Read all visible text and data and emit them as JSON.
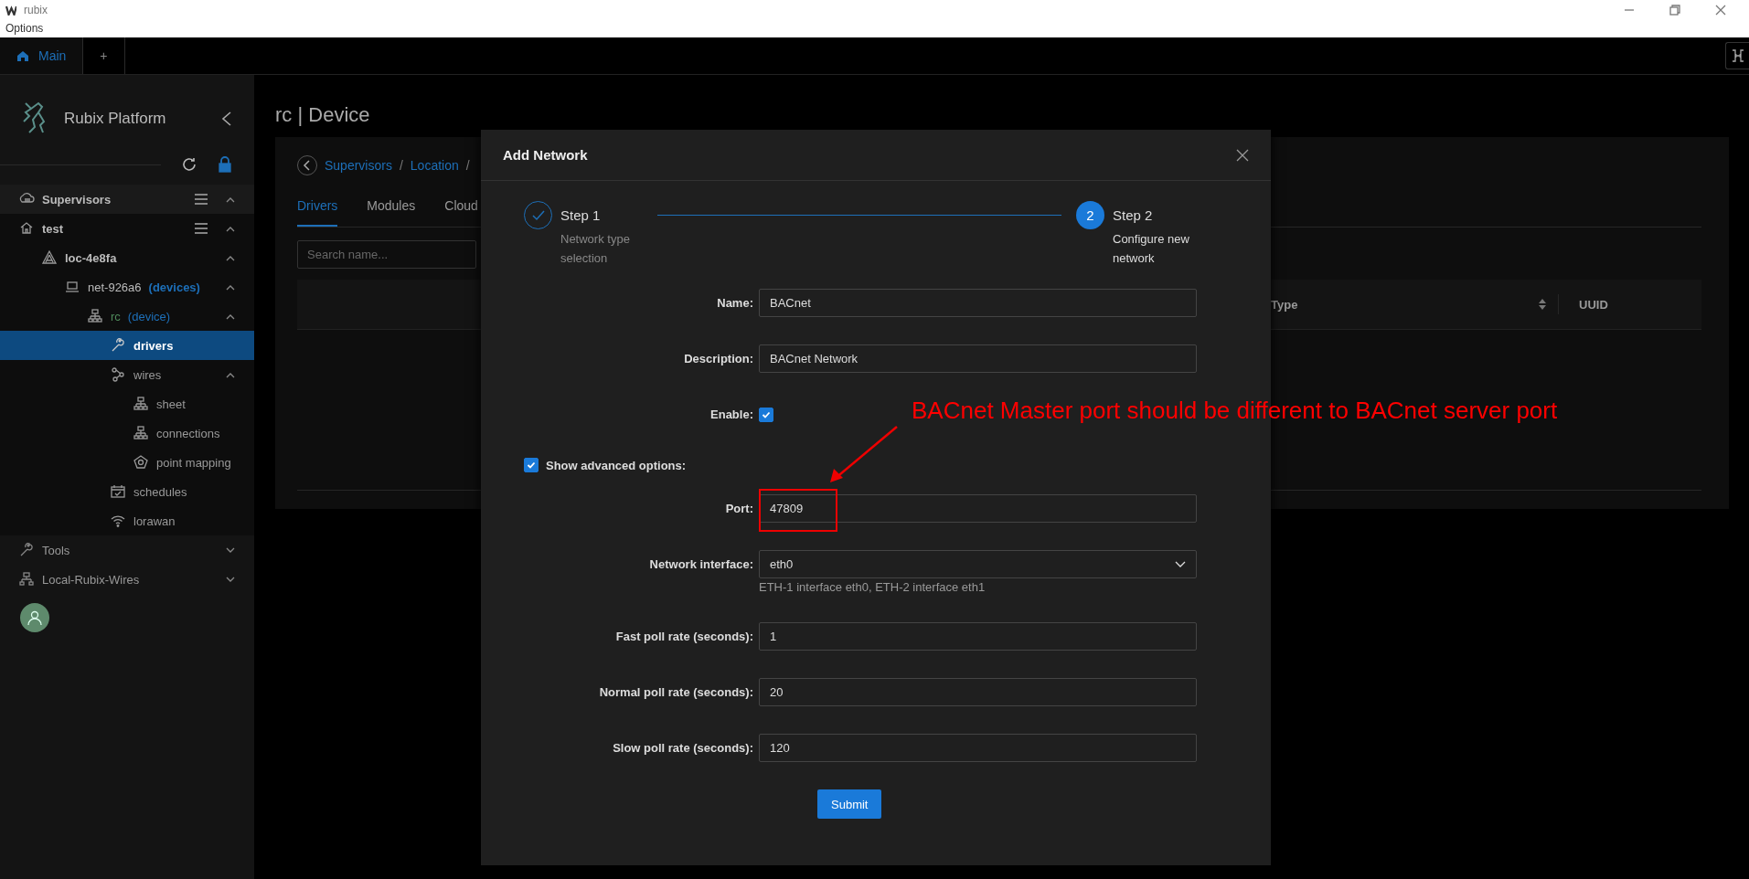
{
  "window": {
    "title": "rubix",
    "menu": [
      "Options"
    ]
  },
  "tabs": [
    {
      "label": "Main",
      "selected": true
    },
    {
      "label": "+",
      "selected": false
    }
  ],
  "sidebar": {
    "title": "Rubix Platform",
    "tree": [
      {
        "kind": "supervisors",
        "label": "Supervisors",
        "expanded": true,
        "selected": false,
        "children": [
          {
            "kind": "host",
            "label": "test",
            "expanded": true,
            "selected": false,
            "children": [
              {
                "kind": "location",
                "label": "loc-4e8fa",
                "expanded": true,
                "selected": false,
                "children": [
                  {
                    "kind": "network",
                    "label": "net-926a6",
                    "suffix": "(devices)",
                    "expanded": true,
                    "selected": false,
                    "children": [
                      {
                        "kind": "device",
                        "label": "rc",
                        "suffix": "(device)",
                        "expanded": true,
                        "selected": false,
                        "children": [
                          {
                            "kind": "drivers",
                            "label": "drivers",
                            "selected": true
                          },
                          {
                            "kind": "wires",
                            "label": "wires",
                            "expanded": true,
                            "selected": false,
                            "children": [
                              {
                                "kind": "sheet",
                                "label": "sheet",
                                "selected": false
                              },
                              {
                                "kind": "sheet",
                                "label": "connections",
                                "selected": false
                              },
                              {
                                "kind": "mapping",
                                "label": "point mapping",
                                "selected": false
                              }
                            ]
                          },
                          {
                            "kind": "schedules",
                            "label": "schedules",
                            "selected": false
                          },
                          {
                            "kind": "lorawan",
                            "label": "lorawan",
                            "selected": false
                          }
                        ]
                      }
                    ]
                  }
                ]
              }
            ]
          }
        ]
      }
    ],
    "footer": [
      {
        "kind": "tools",
        "label": "Tools",
        "expanded": false
      },
      {
        "kind": "wires-app",
        "label": "Local-Rubix-Wires",
        "expanded": false
      }
    ]
  },
  "page": {
    "title": "rc | Device",
    "breadcrumb": [
      {
        "label": "Supervisors",
        "separator": "/"
      },
      {
        "label": "Location",
        "separator": "/"
      }
    ],
    "tabs": [
      {
        "label": "Drivers",
        "selected": true
      },
      {
        "label": "Modules",
        "selected": false
      },
      {
        "label": "Cloud",
        "selected": false
      }
    ],
    "search": {
      "placeholder": "Search name..."
    },
    "table": {
      "columns": [
        {
          "label": "Type",
          "sortable": true
        },
        {
          "label": "UUID",
          "sortable": false
        }
      ]
    }
  },
  "modal": {
    "title": "Add Network",
    "steps": [
      {
        "label": "Step 1",
        "description": "Network type selection",
        "completed": true
      },
      {
        "label": "Step 2",
        "number": "2",
        "description": "Configure new network",
        "completed": false
      }
    ],
    "fields": [
      {
        "kind": "text",
        "label": "Name:",
        "value": "BACnet"
      },
      {
        "kind": "text",
        "label": "Description:",
        "value": "BACnet Network"
      },
      {
        "kind": "checkbox",
        "label": "Enable:",
        "checked": true
      },
      {
        "kind": "toggle",
        "label": "Show advanced options:",
        "checked": true
      },
      {
        "kind": "text",
        "label": "Port:",
        "value": "47809"
      },
      {
        "kind": "select",
        "label": "Network interface:",
        "value": "eth0",
        "help": "ETH-1 interface eth0, ETH-2 interface eth1"
      },
      {
        "kind": "text",
        "label": "Fast poll rate (seconds):",
        "value": "1"
      },
      {
        "kind": "text",
        "label": "Normal poll rate (seconds):",
        "value": "20"
      },
      {
        "kind": "text",
        "label": "Slow poll rate (seconds):",
        "value": "120"
      }
    ],
    "submit": "Submit"
  },
  "annotation": {
    "text": "BACnet Master port should be different to BACnet server port"
  }
}
